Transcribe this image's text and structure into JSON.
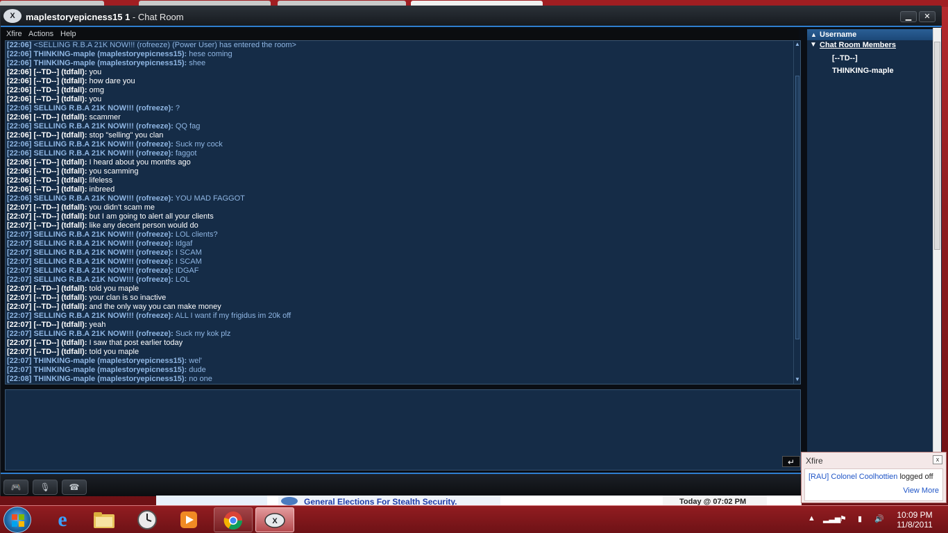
{
  "window": {
    "title_bold": "maplestoryepicness15 1",
    "title_rest": " - Chat Room",
    "minimize_label": "▁",
    "close_label": "✕",
    "logo_label": "X"
  },
  "menu": {
    "items": [
      "Xfire",
      "Actions",
      "Help"
    ]
  },
  "chat": {
    "messages": [
      {
        "ts": "[22:06]",
        "name": "",
        "text": "<SELLING R.B.A 21K NOW!!! (rofreeze) (Power User) has entered the room>",
        "color": "sys"
      },
      {
        "ts": "[22:06]",
        "name": "THINKING-maple (maplestoryepicness15):",
        "text": " hese coming",
        "color": "b"
      },
      {
        "ts": "[22:06]",
        "name": "THINKING-maple (maplestoryepicness15):",
        "text": " shee",
        "color": "b"
      },
      {
        "ts": "[22:06]",
        "name": "[--TD--] (tdfall):",
        "text": " you",
        "color": "w"
      },
      {
        "ts": "[22:06]",
        "name": "[--TD--] (tdfall):",
        "text": " how dare you",
        "color": "w"
      },
      {
        "ts": "[22:06]",
        "name": "[--TD--] (tdfall):",
        "text": " omg",
        "color": "w"
      },
      {
        "ts": "[22:06]",
        "name": "[--TD--] (tdfall):",
        "text": " you",
        "color": "w"
      },
      {
        "ts": "[22:06]",
        "name": "SELLING R.B.A 21K NOW!!! (rofreeze):",
        "text": " ?",
        "color": "b"
      },
      {
        "ts": "[22:06]",
        "name": "[--TD--] (tdfall):",
        "text": " scammer",
        "color": "w"
      },
      {
        "ts": "[22:06]",
        "name": "SELLING R.B.A 21K NOW!!! (rofreeze):",
        "text": " QQ fag",
        "color": "b"
      },
      {
        "ts": "[22:06]",
        "name": "[--TD--] (tdfall):",
        "text": " stop \"selling\" you clan",
        "color": "w"
      },
      {
        "ts": "[22:06]",
        "name": "SELLING R.B.A 21K NOW!!! (rofreeze):",
        "text": " Suck my cock",
        "color": "b"
      },
      {
        "ts": "[22:06]",
        "name": "SELLING R.B.A 21K NOW!!! (rofreeze):",
        "text": " faggot",
        "color": "b"
      },
      {
        "ts": "[22:06]",
        "name": "[--TD--] (tdfall):",
        "text": " I heard about you months ago",
        "color": "w"
      },
      {
        "ts": "[22:06]",
        "name": "[--TD--] (tdfall):",
        "text": " you scamming",
        "color": "w"
      },
      {
        "ts": "[22:06]",
        "name": "[--TD--] (tdfall):",
        "text": " lifeless",
        "color": "w"
      },
      {
        "ts": "[22:06]",
        "name": "[--TD--] (tdfall):",
        "text": " inbreed",
        "color": "w"
      },
      {
        "ts": "[22:06]",
        "name": "SELLING R.B.A 21K NOW!!! (rofreeze):",
        "text": " YOU MAD FAGGOT",
        "color": "b"
      },
      {
        "ts": "[22:07]",
        "name": "[--TD--] (tdfall):",
        "text": " you didn't scam me",
        "color": "w"
      },
      {
        "ts": "[22:07]",
        "name": "[--TD--] (tdfall):",
        "text": " but I am going to alert all your clients",
        "color": "w"
      },
      {
        "ts": "[22:07]",
        "name": "[--TD--] (tdfall):",
        "text": " like any decent person would do",
        "color": "w"
      },
      {
        "ts": "[22:07]",
        "name": "SELLING R.B.A 21K NOW!!! (rofreeze):",
        "text": " LOL clients?",
        "color": "b"
      },
      {
        "ts": "[22:07]",
        "name": "SELLING R.B.A 21K NOW!!! (rofreeze):",
        "text": " Idgaf",
        "color": "b"
      },
      {
        "ts": "[22:07]",
        "name": "SELLING R.B.A 21K NOW!!! (rofreeze):",
        "text": " I SCAM",
        "color": "b"
      },
      {
        "ts": "[22:07]",
        "name": "SELLING R.B.A 21K NOW!!! (rofreeze):",
        "text": " I SCAM",
        "color": "b"
      },
      {
        "ts": "[22:07]",
        "name": "SELLING R.B.A 21K NOW!!! (rofreeze):",
        "text": " IDGAF",
        "color": "b"
      },
      {
        "ts": "[22:07]",
        "name": "SELLING R.B.A 21K NOW!!! (rofreeze):",
        "text": " LOL",
        "color": "b"
      },
      {
        "ts": "[22:07]",
        "name": "[--TD--] (tdfall):",
        "text": " told you maple",
        "color": "w"
      },
      {
        "ts": "[22:07]",
        "name": "[--TD--] (tdfall):",
        "text": " your clan is so inactive",
        "color": "w"
      },
      {
        "ts": "[22:07]",
        "name": "[--TD--] (tdfall):",
        "text": " and the only way you can make money",
        "color": "w"
      },
      {
        "ts": "[22:07]",
        "name": "SELLING R.B.A 21K NOW!!! (rofreeze):",
        "text": " ALL I want if my frigidus im 20k off",
        "color": "b"
      },
      {
        "ts": "[22:07]",
        "name": "[--TD--] (tdfall):",
        "text": " yeah",
        "color": "w"
      },
      {
        "ts": "[22:07]",
        "name": "SELLING R.B.A 21K NOW!!! (rofreeze):",
        "text": " Suck my kok plz",
        "color": "b"
      },
      {
        "ts": "[22:07]",
        "name": "[--TD--] (tdfall):",
        "text": " I saw that post earlier today",
        "color": "w"
      },
      {
        "ts": "[22:07]",
        "name": "[--TD--] (tdfall):",
        "text": " told you maple",
        "color": "w"
      },
      {
        "ts": "[22:07]",
        "name": "THINKING-maple (maplestoryepicness15):",
        "text": " wel'",
        "color": "b"
      },
      {
        "ts": "[22:07]",
        "name": "THINKING-maple (maplestoryepicness15):",
        "text": " dude",
        "color": "b"
      },
      {
        "ts": "[22:08]",
        "name": "THINKING-maple (maplestoryepicness15):",
        "text": " no one",
        "color": "b"
      }
    ],
    "input_value": ""
  },
  "sidebar": {
    "header": "Username",
    "group": "Chat Room Members",
    "members": [
      "[--TD--]",
      "THINKING-maple"
    ]
  },
  "bottom_buttons": [
    "game-controller-icon",
    "microphone-icon",
    "phone-icon"
  ],
  "browser": {
    "link": "General Elections For Stealth Security.",
    "date": "Today @ 07:02 PM"
  },
  "toast": {
    "title": "Xfire",
    "user": "[RAU] Colonel Coolhottien",
    "message": " logged off",
    "more": "View More",
    "close": "x"
  },
  "taskbar": {
    "apps": [
      "internet-explorer-icon",
      "file-explorer-icon",
      "clock-app-icon",
      "media-player-icon",
      "chrome-icon",
      "xfire-icon"
    ],
    "time": "10:09 PM",
    "date": "11/8/2011"
  }
}
